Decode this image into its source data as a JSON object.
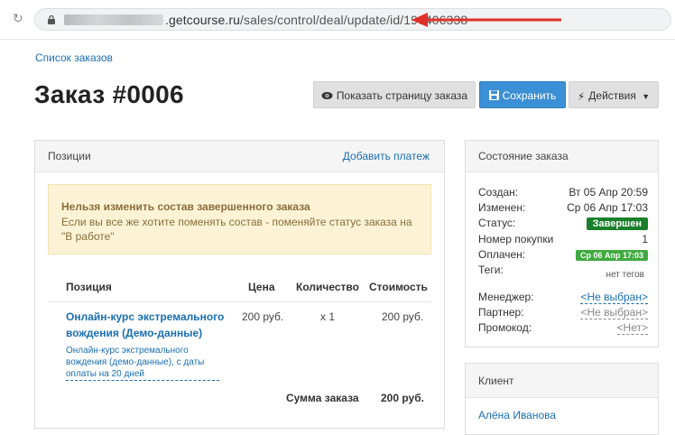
{
  "browser": {
    "url_domain": ".getcourse.ru",
    "url_path": "/sales/control/deal/update/id/196406338"
  },
  "breadcrumb": "Список заказов",
  "page_title": "Заказ #0006",
  "toolbar": {
    "show_page_label": "Показать страницу заказа",
    "save_label": "Сохранить",
    "actions_label": "Действия"
  },
  "positions_panel": {
    "title": "Позиции",
    "add_payment_label": "Добавить платеж",
    "warning": {
      "title": "Нельзя изменить состав завершенного заказа",
      "text": "Если вы все же хотите поменять состав - поменяйте статус заказа на \"В работе\""
    },
    "columns": [
      "Позиция",
      "Цена",
      "Количество",
      "Стоимость"
    ],
    "rows": [
      {
        "name": "Онлайн-курс экстремального вождения (Демо-данные)",
        "description": "Онлайн-курс экстремального вождения (демо-данные), с даты оплаты на 20 дней",
        "price": "200 руб.",
        "quantity": "x 1",
        "cost": "200 руб."
      }
    ],
    "total_label": "Сумма заказа",
    "total_value": "200 руб."
  },
  "state_panel": {
    "title": "Состояние заказа",
    "created_label": "Создан:",
    "created_value": "Вт 05 Апр 20:59",
    "changed_label": "Изменен:",
    "changed_value": "Ср 06 Апр 17:03",
    "status_label": "Статус:",
    "status_value": "Завершен",
    "purchase_no_label": "Номер покупки",
    "purchase_no_value": "1",
    "paid_label": "Оплачен:",
    "paid_value": "Ср 06 Апр 17:03",
    "tags_label": "Теги:",
    "tags_value": "нет тегов",
    "manager_label": "Менеджер:",
    "manager_value": "<Не выбран>",
    "partner_label": "Партнер:",
    "partner_value": "<Не выбран>",
    "promo_label": "Промокод:",
    "promo_value": "<Нет>"
  },
  "client_panel": {
    "title": "Клиент",
    "name": "Алёна Иванова"
  },
  "colors": {
    "link": "#1a6fb5",
    "primary_button": "#3b8fd4",
    "status_green": "#1a7f2a",
    "warning_bg": "#fcf3d6",
    "arrow_red": "#e0302a"
  }
}
